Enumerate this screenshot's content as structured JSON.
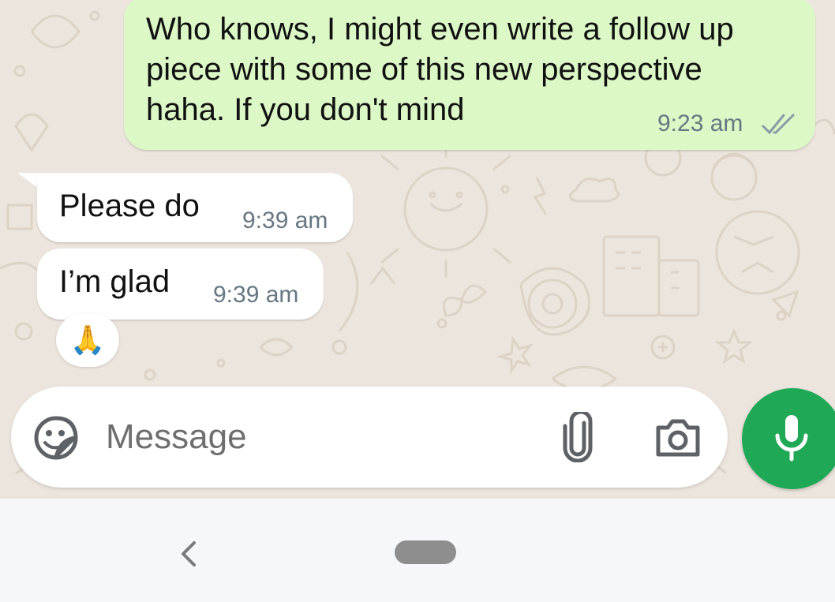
{
  "chat": {
    "messages": [
      {
        "direction": "outgoing",
        "lines": [
          "Who knows, I might even write a follow up",
          "piece with some of this new perspective",
          "haha. If you don't mind"
        ],
        "time": "9:23 am",
        "status_icon": "double-check-icon"
      },
      {
        "direction": "incoming",
        "text": "Please do",
        "time": "9:39 am"
      },
      {
        "direction": "incoming",
        "text": "I’m glad",
        "time": "9:39 am",
        "reaction": "🙏"
      }
    ]
  },
  "composer": {
    "placeholder": "Message",
    "emoji_icon": "sticker-emoji-icon",
    "attach_icon": "paperclip-icon",
    "camera_icon": "camera-icon",
    "mic_icon": "microphone-icon"
  },
  "colors": {
    "outgoing_bubble": "#dcf8c6",
    "incoming_bubble": "#ffffff",
    "chat_background": "#ece5dd",
    "mic_button": "#1fa855",
    "timestamp": "#667781",
    "read_ticks": "#8a9aa5"
  },
  "nav": {
    "back_icon": "back-chevron-icon",
    "home_icon": "home-pill-icon"
  }
}
